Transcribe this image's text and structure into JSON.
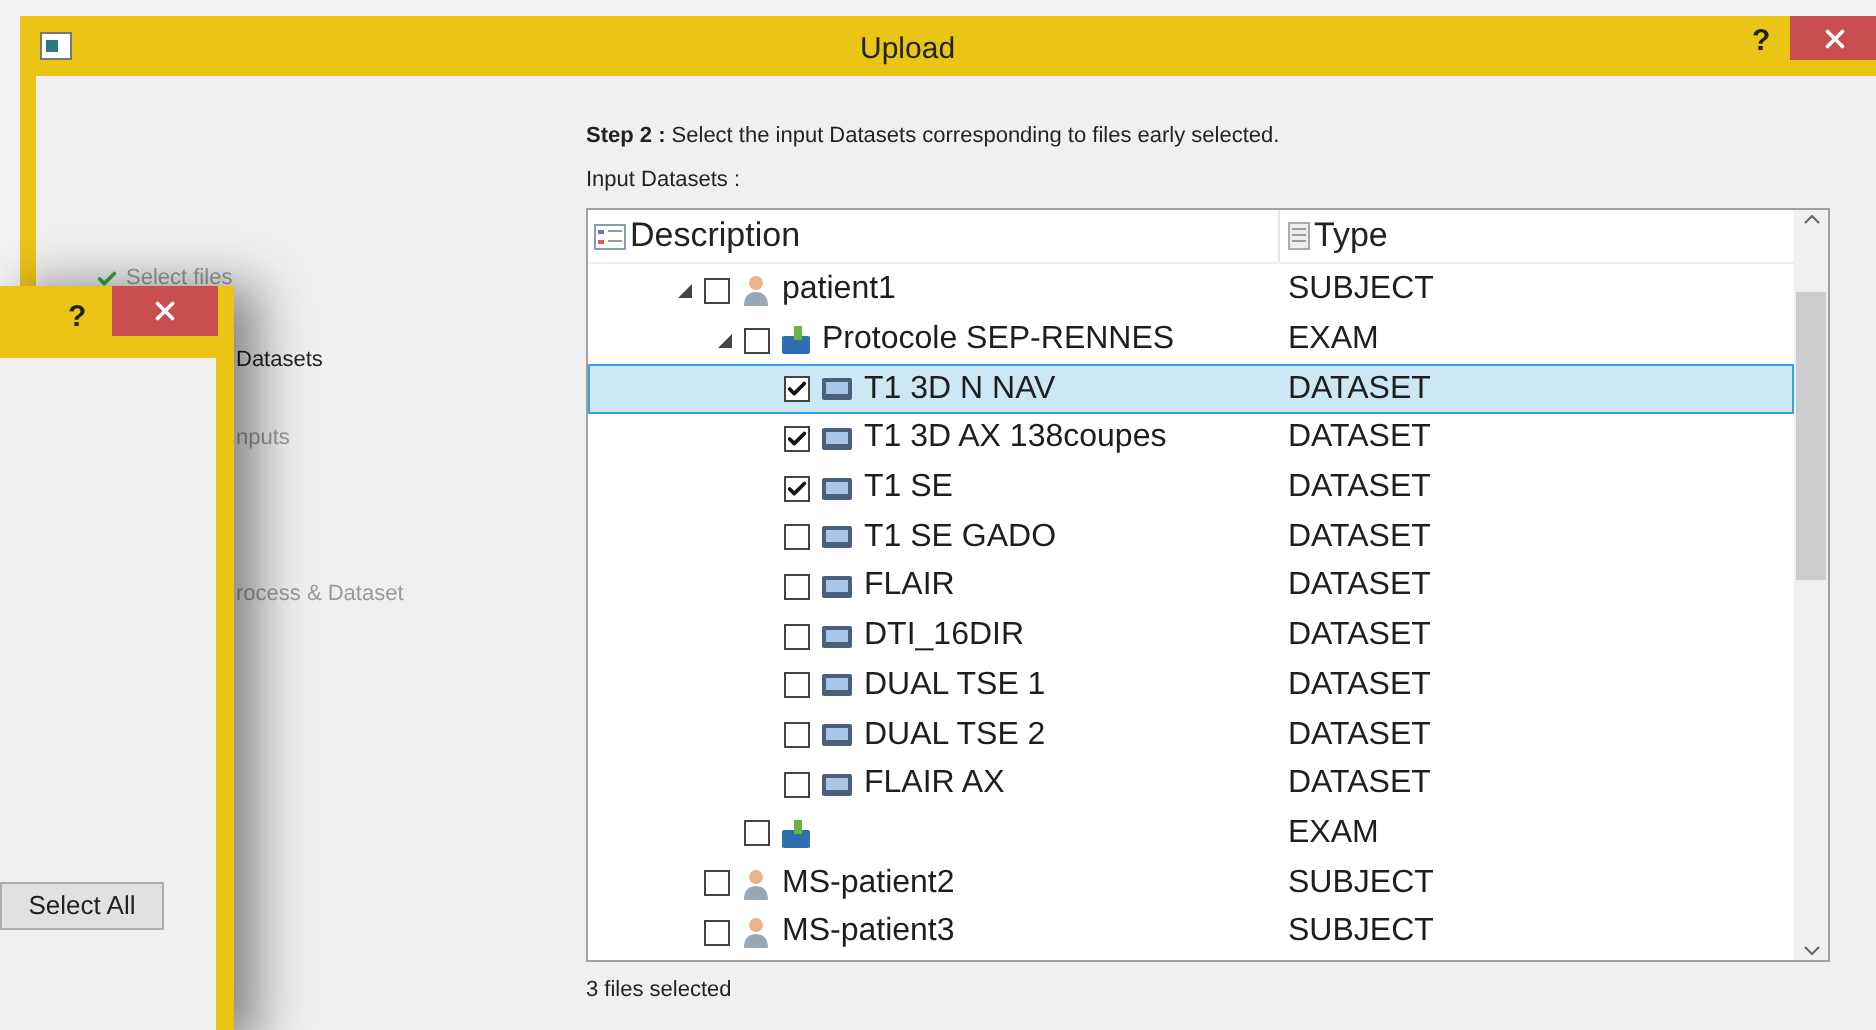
{
  "window": {
    "title": "Upload",
    "help": "?"
  },
  "steps": [
    {
      "label": "Select files",
      "done": true,
      "selected": false
    },
    {
      "label": "Datasets",
      "done": false,
      "selected": true
    },
    {
      "label": "nputs",
      "done": false,
      "selected": false
    },
    {
      "label": "rocess & Dataset",
      "done": false,
      "selected": false
    }
  ],
  "instruction": "**Step 2 :** Select the input Datasets corresponding to files early selected.",
  "input_label": "Input Datasets :",
  "tree": {
    "columns": [
      "Description",
      "Type"
    ],
    "rows": [
      {
        "label": "patient1",
        "type": "SUBJECT",
        "kind": "subject",
        "checked": false,
        "selected": false,
        "expanded": true,
        "children": [
          {
            "label": "Protocole SEP-RENNES",
            "type": "EXAM",
            "kind": "exam",
            "checked": false,
            "selected": false,
            "expanded": true,
            "children": [
              {
                "label": "T1 3D N NAV",
                "type": "DATASET",
                "kind": "dataset",
                "checked": true,
                "selected": true,
                "expanded": false
              },
              {
                "label": "T1 3D AX 138coupes",
                "type": "DATASET",
                "kind": "dataset",
                "checked": true,
                "selected": false,
                "expanded": false
              },
              {
                "label": "T1 SE",
                "type": "DATASET",
                "kind": "dataset",
                "checked": true,
                "selected": false,
                "expanded": false
              },
              {
                "label": "T1 SE GADO",
                "type": "DATASET",
                "kind": "dataset",
                "checked": false,
                "selected": false,
                "expanded": false
              },
              {
                "label": "FLAIR",
                "type": "DATASET",
                "kind": "dataset",
                "checked": false,
                "selected": false,
                "expanded": false
              },
              {
                "label": "DTI_16DIR",
                "type": "DATASET",
                "kind": "dataset",
                "checked": false,
                "selected": false,
                "expanded": false
              },
              {
                "label": "DUAL TSE 1",
                "type": "DATASET",
                "kind": "dataset",
                "checked": false,
                "selected": false,
                "expanded": false
              },
              {
                "label": "DUAL TSE 2",
                "type": "DATASET",
                "kind": "dataset",
                "checked": false,
                "selected": false,
                "expanded": false
              },
              {
                "label": "FLAIR AX",
                "type": "DATASET",
                "kind": "dataset",
                "checked": false,
                "selected": false,
                "expanded": false
              }
            ]
          },
          {
            "type": "EXAM",
            "kind": "exam",
            "checked": false,
            "selected": false,
            "expanded": false
          }
        ]
      },
      {
        "label": "MS-patient2",
        "type": "SUBJECT",
        "kind": "subject",
        "checked": false,
        "selected": false,
        "expanded": false
      },
      {
        "label": "MS-patient3",
        "type": "SUBJECT",
        "kind": "subject",
        "checked": false,
        "selected": false,
        "expanded": false
      }
    ]
  },
  "status": "3 files selected",
  "dialog": {
    "help": "?",
    "button": "Select All"
  }
}
